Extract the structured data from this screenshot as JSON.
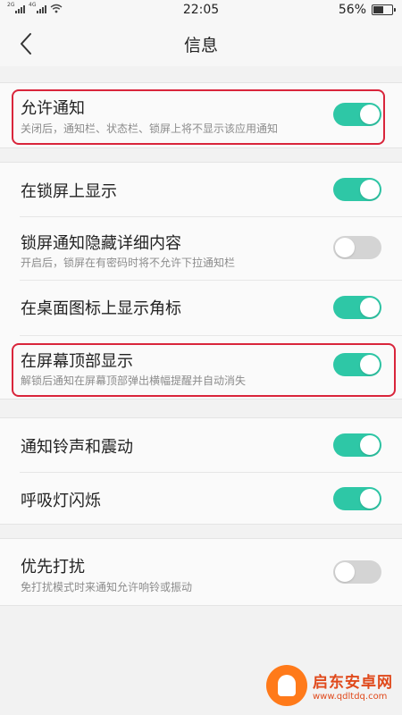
{
  "status_bar": {
    "signal1_label": "2G",
    "signal2_label": "4G",
    "time": "22:05",
    "battery_text": "56%",
    "battery_level": 0.56
  },
  "header": {
    "title": "信息"
  },
  "settings": {
    "allow_notifications": {
      "title": "允许通知",
      "subtitle": "关闭后，通知栏、状态栏、锁屏上将不显示该应用通知",
      "enabled": true
    },
    "show_on_lockscreen": {
      "title": "在锁屏上显示",
      "enabled": true
    },
    "hide_lockscreen_details": {
      "title": "锁屏通知隐藏详细内容",
      "subtitle": "开启后，锁屏在有密码时将不允许下拉通知栏",
      "enabled": false
    },
    "desktop_badge": {
      "title": "在桌面图标上显示角标",
      "enabled": true
    },
    "show_on_top": {
      "title": "在屏幕顶部显示",
      "subtitle": "解锁后通知在屏幕顶部弹出横幅提醒并自动消失",
      "enabled": true
    },
    "ringtone_vibration": {
      "title": "通知铃声和震动",
      "enabled": true
    },
    "breathing_light": {
      "title": "呼吸灯闪烁",
      "enabled": true
    },
    "priority_interrupt": {
      "title": "优先打扰",
      "subtitle": "免打扰模式时来通知允许响铃或振动",
      "enabled": false
    }
  },
  "watermark": {
    "name": "启东安卓网",
    "url": "www.qdltdq.com"
  },
  "colors": {
    "toggle_on": "#2ec7a6",
    "toggle_off": "#d4d4d4",
    "highlight": "#d9253b"
  }
}
